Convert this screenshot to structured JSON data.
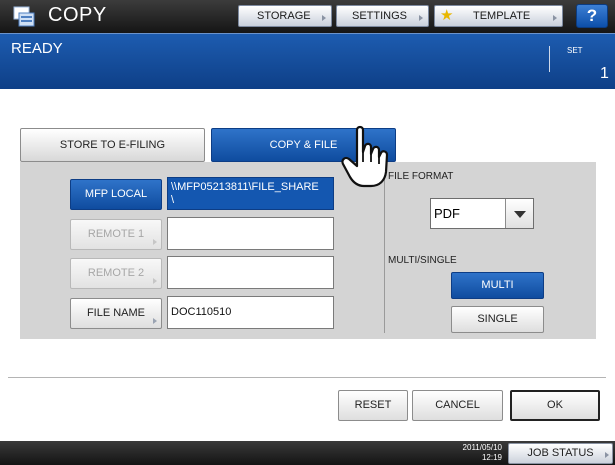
{
  "header": {
    "title": "COPY",
    "buttons": {
      "storage": "STORAGE",
      "settings": "SETTINGS",
      "template": "TEMPLATE",
      "help": "?"
    },
    "icon": "copy-app-icon"
  },
  "status": {
    "text": "READY",
    "set_label": "SET",
    "set_value": "1"
  },
  "tabs": {
    "store_to_efiling": "STORE TO E-FILING",
    "copy_and_file": "COPY & FILE",
    "selected": "COPY & FILE"
  },
  "destinations": {
    "mfp_local": {
      "label": "MFP LOCAL",
      "value": "\\\\MFP05213811\\FILE_SHARE\n\\"
    },
    "remote1": {
      "label": "REMOTE 1",
      "value": ""
    },
    "remote2": {
      "label": "REMOTE 2",
      "value": ""
    },
    "file_name": {
      "label": "FILE NAME",
      "value": "DOC110510"
    }
  },
  "file_format": {
    "label": "FILE FORMAT",
    "selected": "PDF"
  },
  "multi_single": {
    "label": "MULTI/SINGLE",
    "multi": "MULTI",
    "single": "SINGLE",
    "selected": "MULTI"
  },
  "actions": {
    "reset": "RESET",
    "cancel": "CANCEL",
    "ok": "OK"
  },
  "footer": {
    "date": "2011/05/10",
    "time": "12:19",
    "job_status": "JOB STATUS"
  },
  "colors": {
    "accent_blue": "#1457b0",
    "status_bar": "#1d5cb0",
    "title_bar": "#2a2a2a",
    "panel_bg": "#d4d4d4"
  }
}
